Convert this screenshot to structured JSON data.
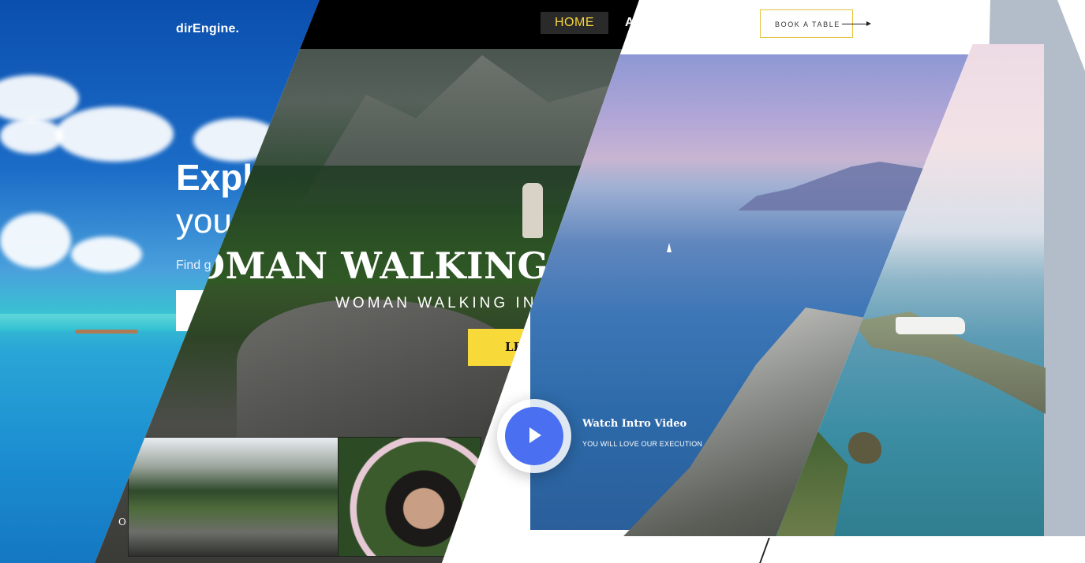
{
  "panel_beach": {
    "logo": "dirEngine.",
    "headline_a": "Expl",
    "headline_b": "you",
    "subtext": "Find g"
  },
  "panel_mountain": {
    "nav": {
      "home_label": "HOME",
      "next_label": "A"
    },
    "title": "OMAN WALKING IN",
    "subtitle": "WOMAN WALKING IN",
    "cta_label": "LE",
    "thumb_letter": "O"
  },
  "panel_ocean": {
    "book_button": "BOOK A TABLE",
    "video_title": "Watch Intro Video",
    "video_subtitle": "YOU WILL LOVE OUR EXECUTION",
    "play_icon": "play-icon",
    "accent_color": "#4a6ff0"
  },
  "colors": {
    "nav_highlight": "#f7d43a",
    "cta_yellow": "#f7d93a",
    "book_border": "#e4c43a"
  }
}
